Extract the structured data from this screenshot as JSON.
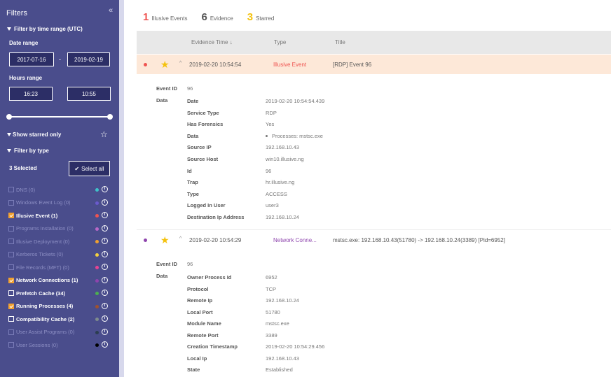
{
  "sidebar": {
    "title": "Filters",
    "time_filter_label": "Filter by time range (UTC)",
    "date_range_label": "Date range",
    "date_from": "2017-07-16",
    "date_to": "2019-02-19",
    "date_separator": "-",
    "hours_range_label": "Hours range",
    "hour_from": "16:23",
    "hour_to": "10:55",
    "starred_label": "Show starred only",
    "type_filter_label": "Filter by type",
    "selected_count": "3 Selected",
    "select_all_label": "Select all",
    "types": [
      {
        "label": "DNS (0)",
        "state": "disabled",
        "color": "#3fc1c9"
      },
      {
        "label": "Windows Event Log (0)",
        "state": "disabled",
        "color": "#6a5acd"
      },
      {
        "label": "Illusive Event (1)",
        "state": "checked",
        "color": "#ef5350"
      },
      {
        "label": "Programs Installation (0)",
        "state": "disabled",
        "color": "#ba68c8"
      },
      {
        "label": "Illusive Deployment (0)",
        "state": "disabled",
        "color": "#f0a030"
      },
      {
        "label": "Kerberos Tickets (0)",
        "state": "disabled",
        "color": "#f4d03f"
      },
      {
        "label": "File Records (MFT) (0)",
        "state": "disabled",
        "color": "#e84393"
      },
      {
        "label": "Network Connections (1)",
        "state": "checked",
        "color": "#8e44ad"
      },
      {
        "label": "Prefetch Cache (34)",
        "state": "unchecked",
        "color": "#4caf50"
      },
      {
        "label": "Running Processes (4)",
        "state": "checked",
        "color": "#a0522d"
      },
      {
        "label": "Compatibility Cache (2)",
        "state": "unchecked",
        "color": "#7f8c8d"
      },
      {
        "label": "User Assist Programs (0)",
        "state": "disabled",
        "color": "#2c3e50"
      },
      {
        "label": "User Sessions (0)",
        "state": "disabled",
        "color": "#000000"
      }
    ]
  },
  "summary": [
    {
      "count": "1",
      "label": "Illusive Events",
      "color": "#ef5350"
    },
    {
      "count": "6",
      "label": "Evidence",
      "color": "#555555"
    },
    {
      "count": "3",
      "label": "Starred",
      "color": "#f4c20d"
    }
  ],
  "table": {
    "headers": {
      "time": "Evidence Time",
      "type": "Type",
      "title": "Title"
    },
    "rows": [
      {
        "time": "2019-02-20 10:54:54",
        "type": "Illusive Event",
        "type_color": "#ef5350",
        "dot_color": "#ef5350",
        "title": "[RDP] Event 96",
        "event_id_label": "Event ID",
        "event_id": "96",
        "data_label": "Data",
        "fields": [
          {
            "k": "Date",
            "v": "2019-02-20 10:54:54.439"
          },
          {
            "k": "Service Type",
            "v": "RDP"
          },
          {
            "k": "Has Forensics",
            "v": "Yes"
          },
          {
            "k": "Data",
            "v": "Processes: mstsc.exe",
            "bullet": true
          },
          {
            "k": "Source IP",
            "v": "192.168.10.43"
          },
          {
            "k": "Source Host",
            "v": "win10.illusive.ng"
          },
          {
            "k": "Id",
            "v": "96"
          },
          {
            "k": "Trap",
            "v": "hr.illusive.ng"
          },
          {
            "k": "Type",
            "v": "ACCESS"
          },
          {
            "k": "Logged In User",
            "v": "user3"
          },
          {
            "k": "Destination Ip Address",
            "v": "192.168.10.24"
          }
        ]
      },
      {
        "time": "2019-02-20 10:54:29",
        "type": "Network Conne...",
        "type_color": "#8e44ad",
        "dot_color": "#8e44ad",
        "title": "mstsc.exe: 192.168.10.43(51780) -> 192.168.10.24(3389) [Pid=6952]",
        "event_id_label": "Event ID",
        "event_id": "96",
        "data_label": "Data",
        "fields": [
          {
            "k": "Owner Process Id",
            "v": "6952"
          },
          {
            "k": "Protocol",
            "v": "TCP"
          },
          {
            "k": "Remote Ip",
            "v": "192.168.10.24"
          },
          {
            "k": "Local Port",
            "v": "51780"
          },
          {
            "k": "Module Name",
            "v": "mstsc.exe"
          },
          {
            "k": "Remote Port",
            "v": "3389"
          },
          {
            "k": "Creation Timestamp",
            "v": "2019-02-20 10:54:29.456"
          },
          {
            "k": "Local Ip",
            "v": "192.168.10.43"
          },
          {
            "k": "State",
            "v": "Established"
          }
        ]
      }
    ]
  }
}
